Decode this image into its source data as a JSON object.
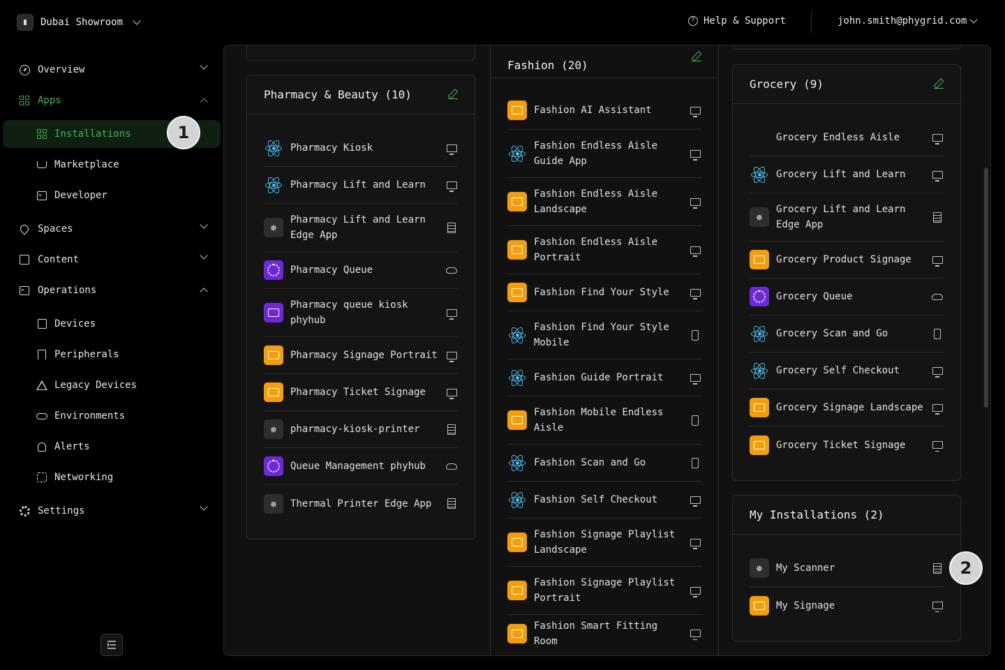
{
  "header": {
    "org_name": "Dubai Showroom",
    "help_label": "Help & Support",
    "user_email": "john.smith@phygrid.com"
  },
  "sidebar": {
    "overview": "Overview",
    "apps": "Apps",
    "installations": "Installations",
    "marketplace": "Marketplace",
    "developer": "Developer",
    "spaces": "Spaces",
    "content": "Content",
    "operations": "Operations",
    "devices": "Devices",
    "peripherals": "Peripherals",
    "legacy_devices": "Legacy Devices",
    "environments": "Environments",
    "alerts": "Alerts",
    "networking": "Networking",
    "settings": "Settings"
  },
  "badges": {
    "one": "1",
    "two": "2"
  },
  "groups": {
    "pharmacy": {
      "title": "Pharmacy & Beauty (10)",
      "apps": [
        {
          "name": "Pharmacy Kiosk",
          "icon": "react-icon",
          "type": "monitor-icon"
        },
        {
          "name": "Pharmacy Lift and Learn",
          "icon": "react-icon",
          "type": "monitor-icon"
        },
        {
          "name": "Pharmacy Lift and Learn Edge App",
          "icon": "edge-icon",
          "type": "edge-device-icon"
        },
        {
          "name": "Pharmacy Queue",
          "icon": "queue-icon",
          "type": "cloud-icon"
        },
        {
          "name": "Pharmacy queue kiosk phyhub",
          "icon": "kiosk-icon",
          "type": "monitor-icon"
        },
        {
          "name": "Pharmacy Signage Portrait",
          "icon": "signage-icon",
          "type": "monitor-icon"
        },
        {
          "name": "Pharmacy Ticket Signage",
          "icon": "ticket-icon",
          "type": "monitor-icon"
        },
        {
          "name": "pharmacy-kiosk-printer",
          "icon": "edge-icon",
          "type": "edge-device-icon"
        },
        {
          "name": "Queue Management phyhub",
          "icon": "queue-icon",
          "type": "cloud-icon"
        },
        {
          "name": "Thermal Printer Edge App",
          "icon": "edge-icon",
          "type": "edge-device-icon"
        }
      ]
    },
    "fashion": {
      "title": "Fashion (20)",
      "apps": [
        {
          "name": "Fashion AI Assistant",
          "icon": "book-icon",
          "type": "monitor-icon"
        },
        {
          "name": "Fashion Endless Aisle Guide App",
          "icon": "react-icon",
          "type": "monitor-icon"
        },
        {
          "name": "Fashion Endless Aisle Landscape",
          "icon": "book-icon",
          "type": "monitor-icon"
        },
        {
          "name": "Fashion Endless Aisle Portrait",
          "icon": "book-icon",
          "type": "monitor-icon"
        },
        {
          "name": "Fashion Find Your Style",
          "icon": "style-icon",
          "type": "monitor-icon"
        },
        {
          "name": "Fashion Find Your Style Mobile",
          "icon": "react-icon",
          "type": "phone-icon"
        },
        {
          "name": "Fashion Guide Portrait",
          "icon": "react-icon",
          "type": "monitor-icon"
        },
        {
          "name": "Fashion Mobile Endless Aisle",
          "icon": "mobile-icon",
          "type": "phone-icon"
        },
        {
          "name": "Fashion Scan and Go",
          "icon": "react-icon",
          "type": "phone-icon"
        },
        {
          "name": "Fashion Self Checkout",
          "icon": "react-icon",
          "type": "monitor-icon"
        },
        {
          "name": "Fashion Signage Playlist Landscape",
          "icon": "signage-icon",
          "type": "monitor-icon"
        },
        {
          "name": "Fashion Signage Playlist Portrait",
          "icon": "signage-icon",
          "type": "monitor-icon"
        },
        {
          "name": "Fashion Smart Fitting Room",
          "icon": "fitting-icon",
          "type": "monitor-icon"
        }
      ]
    },
    "grocery": {
      "title": "Grocery (9)",
      "apps": [
        {
          "name": "Grocery Endless Aisle",
          "icon": "blank-icon",
          "type": "monitor-icon"
        },
        {
          "name": "Grocery Lift and Learn",
          "icon": "react-icon",
          "type": "monitor-icon"
        },
        {
          "name": "Grocery Lift and Learn Edge App",
          "icon": "edge-icon",
          "type": "edge-device-icon"
        },
        {
          "name": "Grocery Product Signage",
          "icon": "signage-icon",
          "type": "monitor-icon"
        },
        {
          "name": "Grocery Queue",
          "icon": "queue-icon",
          "type": "cloud-icon"
        },
        {
          "name": "Grocery Scan and Go",
          "icon": "react-icon",
          "type": "phone-icon"
        },
        {
          "name": "Grocery Self Checkout",
          "icon": "react-icon",
          "type": "monitor-icon"
        },
        {
          "name": "Grocery Signage Landscape",
          "icon": "signage-icon",
          "type": "monitor-icon"
        },
        {
          "name": "Grocery Ticket Signage",
          "icon": "ticket-icon",
          "type": "monitor-icon"
        }
      ]
    },
    "mine": {
      "title": "My Installations (2)",
      "apps": [
        {
          "name": "My Scanner",
          "icon": "edge-icon",
          "type": "edge-device-icon"
        },
        {
          "name": "My Signage",
          "icon": "signage-icon",
          "type": "monitor-icon"
        }
      ]
    }
  },
  "colors": {
    "accent": "#3fb950",
    "orange": "#f59e0b",
    "purple": "#6d28d9",
    "react": "#4fc3f7"
  }
}
